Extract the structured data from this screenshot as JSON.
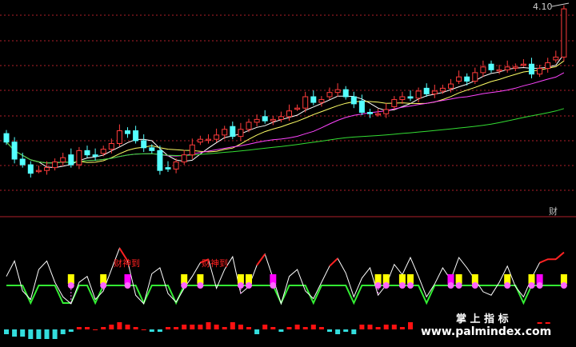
{
  "price_panel": {
    "price_label": "4.10",
    "colors": {
      "up": "#ff3b3b",
      "down": "#54ffff",
      "ma_short": "#ffffff",
      "ma_mid": "#ffff66",
      "ma_long": "#ff44ff",
      "ma_longer": "#33dd33",
      "grid": "#b0202a"
    }
  },
  "indicator_panel": {
    "tag": "财",
    "signal_label": "财神到",
    "colors": {
      "osc": "#ffffff",
      "osc_hot": "#ff2222",
      "baseline": "#33ee33",
      "baseline_peak": "#22ff44",
      "marker": "#ff66ff",
      "bar_yellow": "#ffff00",
      "bar_magenta": "#ff00ff",
      "hist_up": "#ff1111",
      "hist_down": "#33dddd"
    }
  },
  "watermark": {
    "title": "掌 上 指 标",
    "url": "www.palmindex.com"
  },
  "chart_data": {
    "type": "candlestick",
    "close": [
      3.14,
      3.02,
      2.98,
      2.92,
      2.94,
      2.96,
      3.0,
      3.03,
      2.98,
      3.08,
      3.05,
      3.04,
      3.09,
      3.13,
      3.22,
      3.2,
      3.15,
      3.1,
      3.08,
      2.94,
      2.95,
      3.0,
      3.05,
      3.12,
      3.16,
      3.16,
      3.19,
      3.23,
      3.18,
      3.23,
      3.28,
      3.3,
      3.29,
      3.3,
      3.32,
      3.36,
      3.38,
      3.46,
      3.42,
      3.44,
      3.49,
      3.51,
      3.46,
      3.41,
      3.35,
      3.34,
      3.34,
      3.37,
      3.44,
      3.46,
      3.45,
      3.5,
      3.48,
      3.5,
      3.52,
      3.55,
      3.6,
      3.57,
      3.63,
      3.67,
      3.65,
      3.65,
      3.67,
      3.67,
      3.69,
      3.62,
      3.66,
      3.7,
      3.74,
      4.08
    ],
    "ylim": [
      2.8,
      4.12
    ],
    "overlays": [
      "MA5",
      "MA10",
      "MA20",
      "MA60"
    ],
    "indicator": {
      "osc": [
        0.62,
        0.8,
        0.45,
        0.35,
        0.7,
        0.8,
        0.55,
        0.38,
        0.3,
        0.55,
        0.62,
        0.35,
        0.45,
        0.7,
        0.95,
        0.8,
        0.4,
        0.3,
        0.65,
        0.72,
        0.42,
        0.32,
        0.48,
        0.62,
        0.78,
        0.82,
        0.48,
        0.7,
        0.85,
        0.42,
        0.5,
        0.75,
        0.88,
        0.6,
        0.3,
        0.62,
        0.7,
        0.45,
        0.36,
        0.55,
        0.74,
        0.83,
        0.66,
        0.38,
        0.6,
        0.72,
        0.4,
        0.52,
        0.76,
        0.64,
        0.84,
        0.62,
        0.38,
        0.53,
        0.72,
        0.58,
        0.84,
        0.72,
        0.58,
        0.44,
        0.4,
        0.55,
        0.74,
        0.5,
        0.38,
        0.6,
        0.78,
        0.82,
        0.82,
        0.9
      ],
      "hist": [
        -2,
        -3,
        -3,
        -4,
        -4,
        -4,
        -4,
        -2,
        -1,
        1,
        1,
        0,
        1,
        2,
        3,
        2,
        1,
        0,
        -1,
        -1,
        1,
        1,
        2,
        2,
        2,
        3,
        2,
        1,
        3,
        2,
        1,
        -2,
        2,
        1,
        -1,
        1,
        2,
        1,
        2,
        1,
        -1,
        -2,
        -1,
        -2,
        2,
        2,
        1,
        2,
        2,
        1,
        3,
        1,
        -2,
        1,
        2,
        2,
        2,
        1,
        -1,
        1,
        1,
        2,
        2,
        1,
        2,
        2,
        3,
        3,
        2,
        2
      ],
      "signals": [
        5,
        14,
        25,
        33,
        38,
        43,
        50,
        55,
        59,
        64,
        71,
        81,
        87,
        95,
        108,
        113,
        116,
        121,
        127,
        134,
        140
      ]
    }
  }
}
